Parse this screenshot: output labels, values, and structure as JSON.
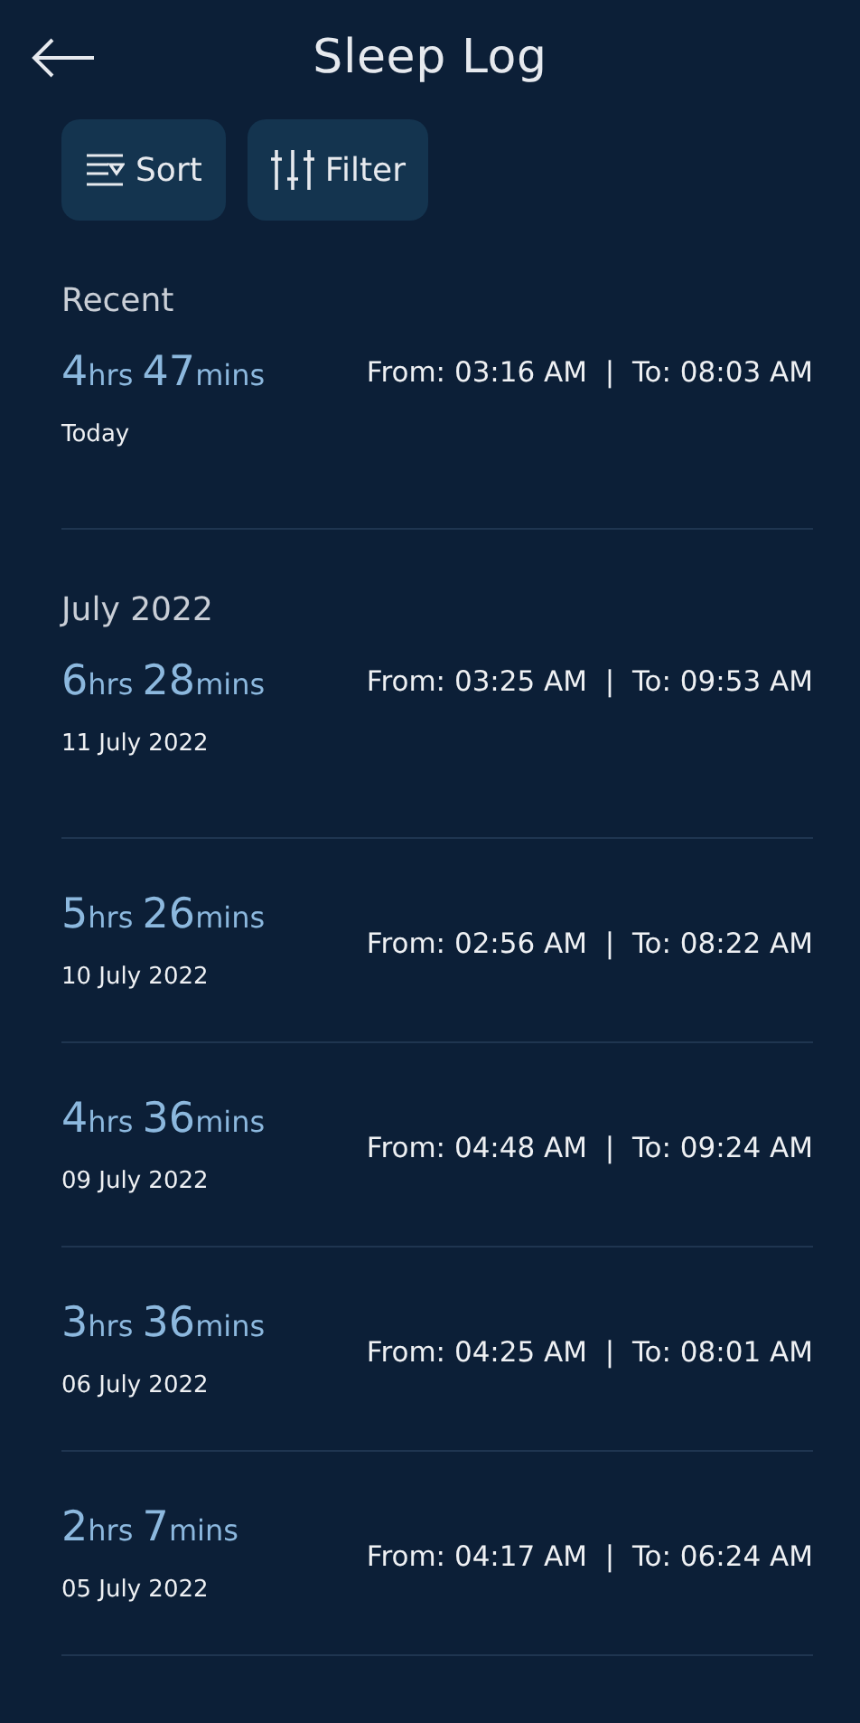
{
  "header": {
    "title": "Sleep Log"
  },
  "actions": [
    {
      "kind": "sort",
      "label": "Sort"
    },
    {
      "kind": "filter",
      "label": "Filter"
    }
  ],
  "sections": [
    {
      "heading": "Recent",
      "entries": [
        {
          "hours": "4",
          "hours_unit": "hrs",
          "minutes": "47",
          "minutes_unit": "mins",
          "date": "Today",
          "range": "From: 03:16 AM  |  To: 08:03 AM"
        }
      ]
    },
    {
      "heading": "July 2022",
      "entries": [
        {
          "hours": "6",
          "hours_unit": "hrs",
          "minutes": "28",
          "minutes_unit": "mins",
          "date": "11 July 2022",
          "range": "From: 03:25 AM  |  To: 09:53 AM"
        },
        {
          "hours": "5",
          "hours_unit": "hrs",
          "minutes": "26",
          "minutes_unit": "mins",
          "date": "10 July 2022",
          "range": "From: 02:56 AM  |  To: 08:22 AM"
        },
        {
          "hours": "4",
          "hours_unit": "hrs",
          "minutes": "36",
          "minutes_unit": "mins",
          "date": "09 July 2022",
          "range": "From: 04:48 AM  |  To: 09:24 AM"
        },
        {
          "hours": "3",
          "hours_unit": "hrs",
          "minutes": "36",
          "minutes_unit": "mins",
          "date": "06 July 2022",
          "range": "From: 04:25 AM  |  To: 08:01 AM"
        },
        {
          "hours": "2",
          "hours_unit": "hrs",
          "minutes": "7",
          "minutes_unit": "mins",
          "date": "05 July 2022",
          "range": "From: 04:17 AM  |  To: 06:24 AM"
        }
      ]
    }
  ]
}
